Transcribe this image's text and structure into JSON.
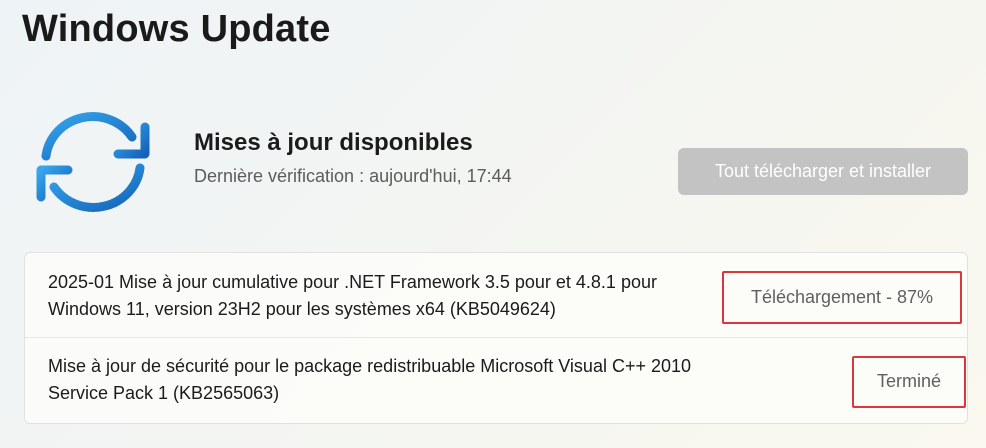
{
  "page": {
    "title": "Windows Update"
  },
  "status_panel": {
    "icon": "sync-icon",
    "heading": "Mises à jour disponibles",
    "last_check": "Dernière vérification : aujourd'hui, 17:44",
    "install_button_label": "Tout télécharger et installer",
    "install_button_enabled": false
  },
  "updates": [
    {
      "name": "2025-01 Mise à jour cumulative pour .NET Framework 3.5 pour et 4.8.1 pour Windows 11, version 23H2 pour les systèmes x64 (KB5049624)",
      "status": "Téléchargement - 87%",
      "progress_percent": 87
    },
    {
      "name": "Mise à jour de sécurité pour le package redistribuable Microsoft Visual C++ 2010 Service Pack 1 (KB2565063)",
      "status": "Terminé"
    }
  ],
  "colors": {
    "accent_blue": "#1a86d9",
    "highlight_red": "#d9363e",
    "disabled_button": "#c3c3c3"
  }
}
